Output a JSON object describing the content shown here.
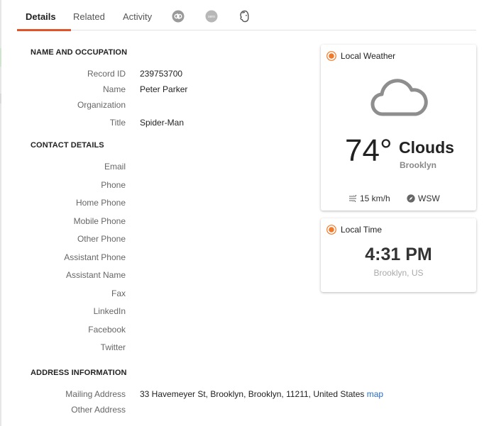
{
  "tabs": [
    {
      "label": "Details",
      "active": true
    },
    {
      "label": "Related",
      "active": false
    },
    {
      "label": "Activity",
      "active": false
    }
  ],
  "tab_icons": [
    "quickbooks-icon",
    "xero-icon",
    "mailchimp-icon"
  ],
  "xero_text": "xero",
  "name_section": {
    "title": "NAME AND OCCUPATION",
    "fields": [
      {
        "label": "Record ID",
        "value": "239753700"
      },
      {
        "label": "Name",
        "value": "Peter Parker"
      },
      {
        "label": "Organization",
        "value": ""
      },
      {
        "label": "Title",
        "value": "Spider-Man"
      }
    ]
  },
  "contact_section": {
    "title": "CONTACT DETAILS",
    "fields": [
      {
        "label": "Email",
        "value": ""
      },
      {
        "label": "Phone",
        "value": ""
      },
      {
        "label": "Home Phone",
        "value": ""
      },
      {
        "label": "Mobile Phone",
        "value": ""
      },
      {
        "label": "Other Phone",
        "value": ""
      },
      {
        "label": "Assistant Phone",
        "value": ""
      },
      {
        "label": "Assistant Name",
        "value": ""
      },
      {
        "label": "Fax",
        "value": ""
      },
      {
        "label": "LinkedIn",
        "value": ""
      },
      {
        "label": "Facebook",
        "value": ""
      },
      {
        "label": "Twitter",
        "value": ""
      }
    ]
  },
  "address_section": {
    "title": "ADDRESS INFORMATION",
    "fields": [
      {
        "label": "Mailing Address",
        "value": "33 Havemeyer St, Brooklyn, Brooklyn, 11211, United States",
        "link": "map"
      },
      {
        "label": "Other Address",
        "value": ""
      }
    ]
  },
  "weather": {
    "title": "Local Weather",
    "temperature": "74°",
    "condition": "Clouds",
    "location": "Brooklyn",
    "wind_speed": "15 km/h",
    "wind_direction": "WSW"
  },
  "local_time": {
    "title": "Local Time",
    "time": "4:31 PM",
    "location": "Brooklyn, US"
  },
  "colors": {
    "accent": "#e0532b",
    "link": "#2a6cc4",
    "sun": "#f07a2a"
  }
}
